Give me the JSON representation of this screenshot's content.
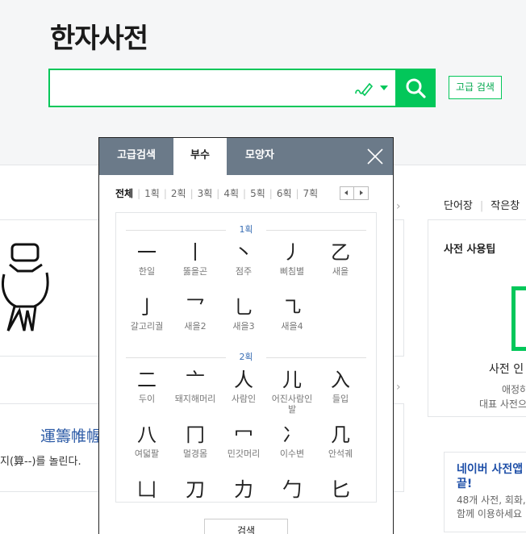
{
  "header": {
    "title": "한자사전",
    "search_placeholder": "",
    "advanced_search_label": "고급 검색"
  },
  "colors": {
    "accent": "#03c75a",
    "popup_tab_bg": "#6b7a89",
    "link_blue": "#2b5aa6"
  },
  "icons": {
    "handwrite": "handwriting-pen-icon",
    "dropdown": "triangle-down-icon",
    "search": "magnifier-icon",
    "close": "x-close-icon"
  },
  "background": {
    "sample_hanja": "運籌帷幄",
    "sample_desc": "지(算--)를 놀린다.",
    "right_tabs": [
      "단어장",
      "작은창"
    ],
    "tips_title": "사전 사용팁",
    "tip_line1": "사전 인",
    "tip_line2": "애정하",
    "tip_line3": "대표 사전으",
    "promo_title": "네이버 사전앱 끝!",
    "promo_desc_line1": "48개 사전, 회화,",
    "promo_desc_line2": "함께 이용하세요"
  },
  "popup": {
    "tabs": [
      "고급검색",
      "부수",
      "모양자"
    ],
    "active_tab": "부수",
    "strokes": [
      "전체",
      "1획",
      "2획",
      "3획",
      "4획",
      "5획",
      "6획",
      "7획"
    ],
    "active_stroke": "전체",
    "search_button": "검색",
    "groups": [
      {
        "label": "1획",
        "radicals": [
          {
            "char": "一",
            "name": "한일"
          },
          {
            "char": "丨",
            "name": "뚫을곤"
          },
          {
            "char": "丶",
            "name": "점주"
          },
          {
            "char": "丿",
            "name": "삐침별"
          },
          {
            "char": "乙",
            "name": "새을"
          },
          {
            "char": "亅",
            "name": "갈고리궐"
          },
          {
            "char": "乛",
            "name": "새을2"
          },
          {
            "char": "乚",
            "name": "새을3"
          },
          {
            "char": "㇈",
            "name": "새을4"
          }
        ]
      },
      {
        "label": "2획",
        "radicals": [
          {
            "char": "二",
            "name": "두이"
          },
          {
            "char": "亠",
            "name": "돼지해머리"
          },
          {
            "char": "人",
            "name": "사람인"
          },
          {
            "char": "儿",
            "name": "어진사람인발"
          },
          {
            "char": "入",
            "name": "들입"
          },
          {
            "char": "八",
            "name": "여덟팔"
          },
          {
            "char": "冂",
            "name": "멀경몸"
          },
          {
            "char": "冖",
            "name": "민갓머리"
          },
          {
            "char": "冫",
            "name": "이수변"
          },
          {
            "char": "几",
            "name": "안석궤"
          },
          {
            "char": "凵",
            "name": ""
          },
          {
            "char": "刀",
            "name": ""
          },
          {
            "char": "力",
            "name": ""
          },
          {
            "char": "勹",
            "name": ""
          },
          {
            "char": "匕",
            "name": ""
          }
        ]
      }
    ]
  }
}
